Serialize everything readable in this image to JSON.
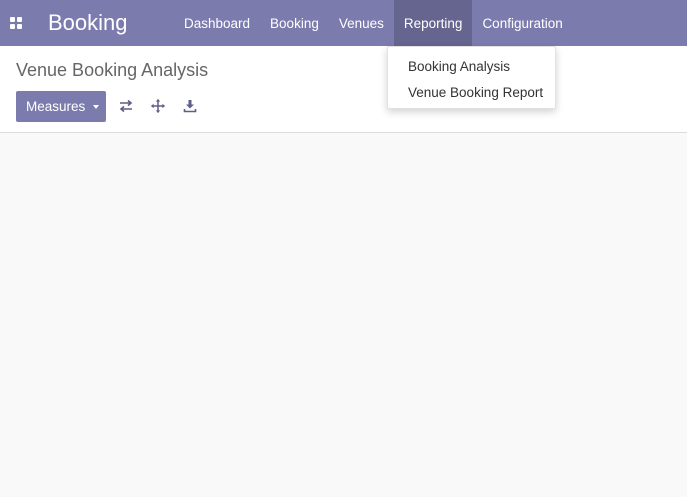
{
  "navbar": {
    "apps_icon": "apps-grid-icon",
    "brand": "Booking",
    "menu": [
      {
        "label": "Dashboard"
      },
      {
        "label": "Booking"
      },
      {
        "label": "Venues"
      },
      {
        "label": "Reporting"
      },
      {
        "label": "Configuration"
      }
    ],
    "active_menu": "Reporting"
  },
  "dropdown": {
    "items": [
      {
        "label": "Booking Analysis"
      },
      {
        "label": "Venue Booking Report"
      }
    ]
  },
  "control_panel": {
    "title": "Venue Booking Analysis",
    "measures_label": "Measures",
    "tools": [
      "flip-axis-icon",
      "expand-all-icon",
      "download-icon"
    ]
  },
  "colors": {
    "brand": "#7c7bad",
    "brand_active": "#66658f",
    "content_bg": "#f9f9f9"
  }
}
